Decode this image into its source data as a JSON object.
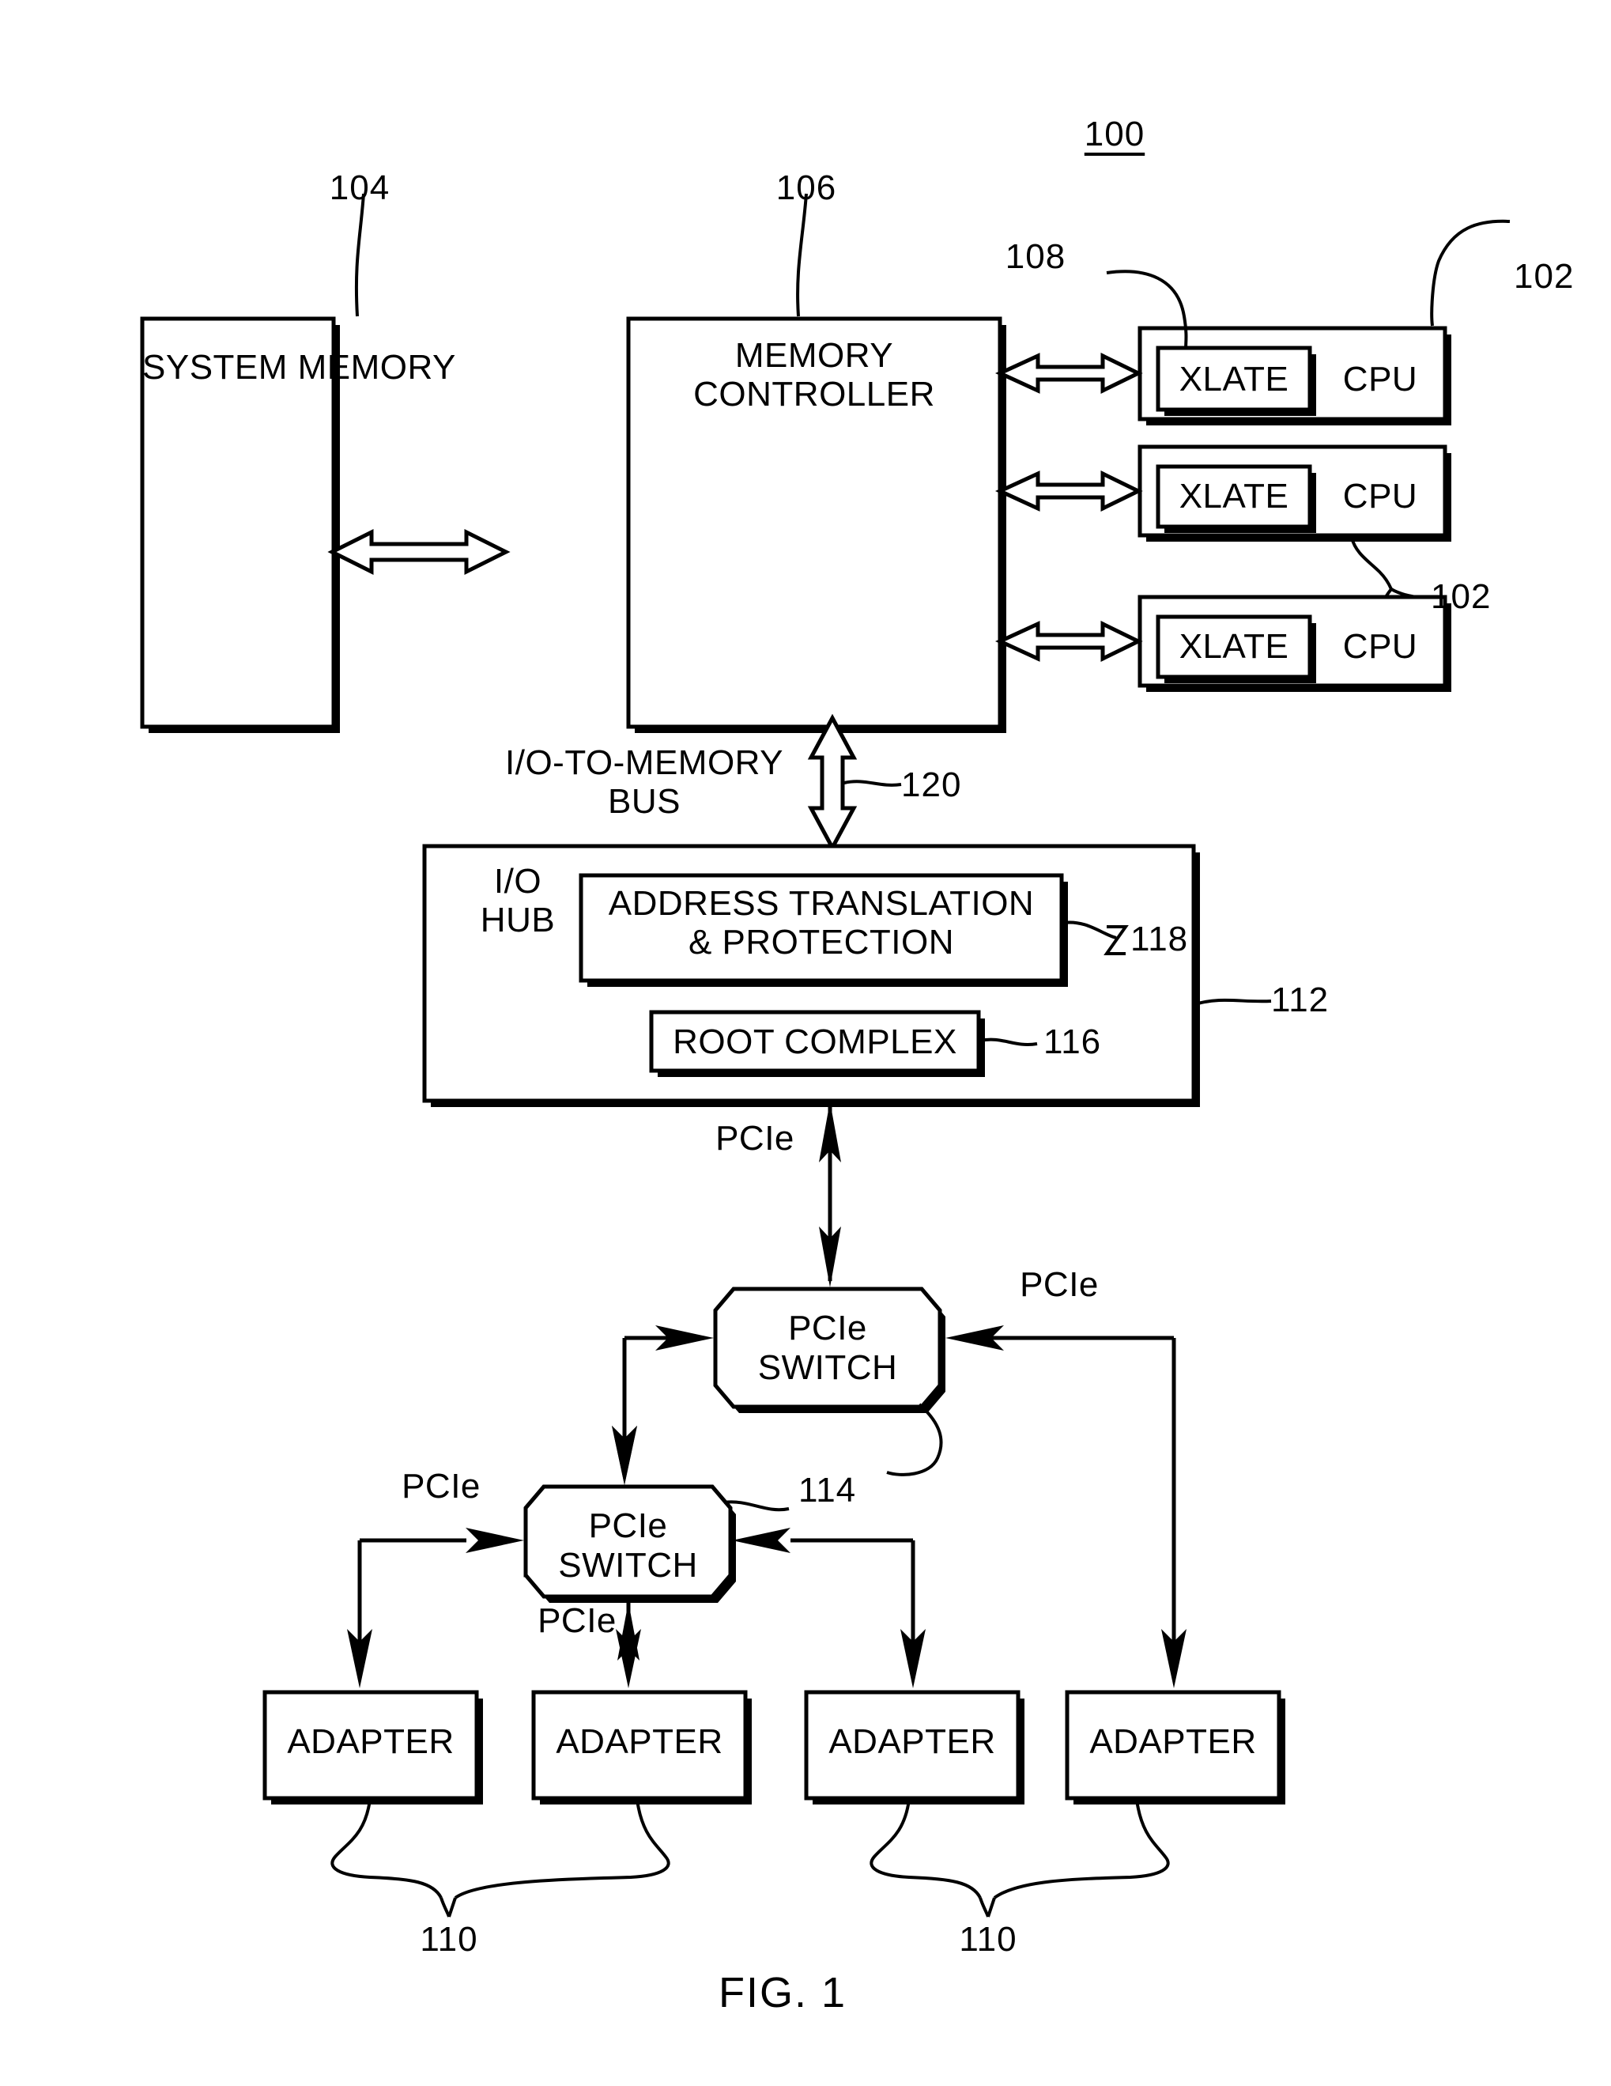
{
  "figure": {
    "caption": "FIG. 1",
    "system_number": "100"
  },
  "blocks": {
    "system_memory": {
      "label": "SYSTEM MEMORY",
      "ref": "104"
    },
    "memory_controller": {
      "label": "MEMORY\nCONTROLLER",
      "ref": "106"
    },
    "io_hub": {
      "label": "I/O\nHUB",
      "ref": "112"
    },
    "address_translation": {
      "label": "ADDRESS TRANSLATION\n& PROTECTION",
      "ref": "118"
    },
    "root_complex": {
      "label": "ROOT COMPLEX",
      "ref": "116"
    },
    "xlate": {
      "label": "XLATE",
      "ref": "108"
    },
    "cpu": {
      "label": "CPU",
      "ref": "102",
      "ref_lower": "102"
    },
    "pcie_switch": {
      "label": "PCIe\nSWITCH",
      "ref": "114"
    },
    "adapter": {
      "label": "ADAPTER",
      "ref_left": "110",
      "ref_right": "110"
    }
  },
  "cpus": [
    {
      "xlate": "XLATE",
      "cpu": "CPU"
    },
    {
      "xlate": "XLATE",
      "cpu": "CPU"
    },
    {
      "xlate": "XLATE",
      "cpu": "CPU"
    }
  ],
  "switches": [
    {
      "line1": "PCIe",
      "line2": "SWITCH"
    },
    {
      "line1": "PCIe",
      "line2": "SWITCH"
    }
  ],
  "adapters": [
    {
      "label": "ADAPTER"
    },
    {
      "label": "ADAPTER"
    },
    {
      "label": "ADAPTER"
    },
    {
      "label": "ADAPTER"
    }
  ],
  "bus": {
    "io_to_memory_label": "I/O-TO-MEMORY\nBUS",
    "io_to_memory_ref": "120"
  },
  "link_labels": {
    "pcie_hub_to_switch": "PCIe",
    "pcie_switch1_right": "PCIe",
    "pcie_switch2_left": "PCIe",
    "pcie_switch2_down": "PCIe"
  },
  "refs": {
    "r100": "100",
    "r102a": "102",
    "r102b": "102",
    "r104": "104",
    "r106": "106",
    "r108": "108",
    "r110a": "110",
    "r110b": "110",
    "r112": "112",
    "r114": "114",
    "r116": "116",
    "r118": "118",
    "r120": "120"
  },
  "colors": {
    "ink": "#000000",
    "paper": "#ffffff"
  }
}
